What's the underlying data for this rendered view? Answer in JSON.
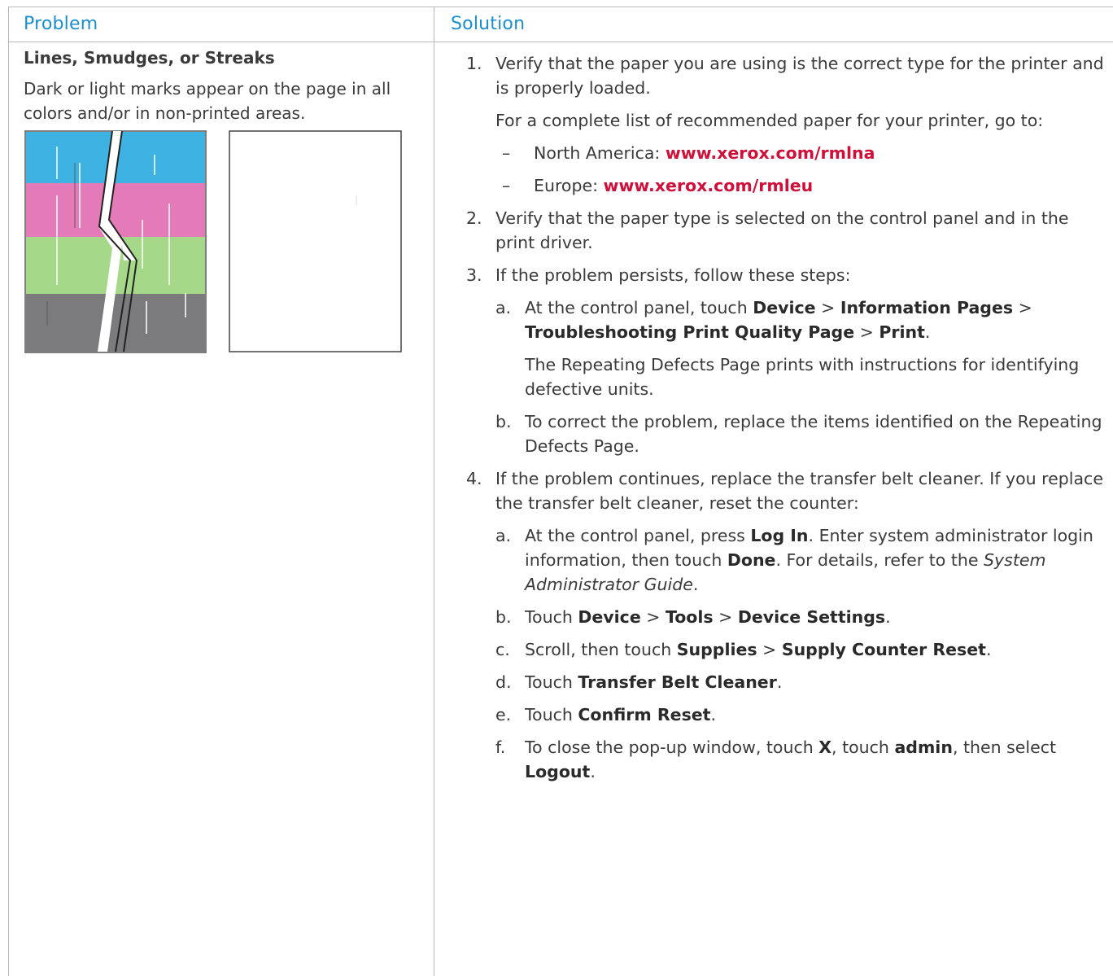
{
  "headers": {
    "problem": "Problem",
    "solution": "Solution"
  },
  "problem": {
    "title": "Lines, Smudges, or Streaks",
    "description": "Dark or light marks appear on the page in all colors and/or in non-printed areas."
  },
  "solution": {
    "s1_num": "1.",
    "s1_text": "Verify that the paper you are using is the correct type for the printer and is properly loaded.",
    "s1_note": "For a complete list of recommended paper for your printer, go to:",
    "dash": "–",
    "na_label": "North America: ",
    "na_link": "www.xerox.com/rmlna",
    "eu_label": "Europe: ",
    "eu_link": "www.xerox.com/rmleu",
    "s2_num": "2.",
    "s2_text": "Verify that the paper type is selected on the control panel and in the print driver.",
    "s3_num": "3.",
    "s3_text": "If the problem persists, follow these steps:",
    "s3a_num": "a.",
    "s3a_pre": "At the control panel, touch ",
    "s3a_b1": "Device",
    "gt": " > ",
    "s3a_b2": "Information Pages",
    "s3a_b3": "Troubleshooting Print Quality Page",
    "s3a_b4": "Print",
    "period": ".",
    "s3a_note": "The Repeating Defects Page prints with instructions for identifying defective units.",
    "s3b_num": "b.",
    "s3b_text": "To correct the problem, replace the items identified on the Repeating Defects Page.",
    "s4_num": "4.",
    "s4_text": "If the problem continues, replace the transfer belt cleaner. If you replace the transfer belt cleaner, reset the counter:",
    "s4a_num": "a.",
    "s4a_pre": "At the control panel, press ",
    "s4a_b1": "Log In",
    "s4a_mid1": ". Enter system administrator login information, then touch ",
    "s4a_b2": "Done",
    "s4a_mid2": ". For details, refer to the ",
    "s4a_i": "System Administrator Guide",
    "s4b_num": "b.",
    "touch": "Touch ",
    "s4b_b1": "Device",
    "s4b_b2": "Tools",
    "s4b_b3": "Device Settings",
    "s4c_num": "c.",
    "s4c_pre": "Scroll, then touch ",
    "s4c_b1": "Supplies",
    "s4c_b2": "Supply Counter Reset",
    "s4d_num": "d.",
    "s4d_b1": "Transfer Belt Cleaner",
    "s4e_num": "e.",
    "s4e_b1": "Confirm Reset",
    "s4f_num": "f.",
    "s4f_pre": "To close the pop-up window, touch ",
    "s4f_b1": "X",
    "comma_touch": ", touch ",
    "s4f_b2": "admin",
    "then_select": ", then select ",
    "s4f_b3": "Logout"
  },
  "colors": {
    "heading": "#1a8fd0",
    "link": "#d0103a",
    "cyan": "#3eb3e3",
    "magenta": "#e57ab8",
    "green": "#a6d88a",
    "gray": "#7b7b7d"
  }
}
